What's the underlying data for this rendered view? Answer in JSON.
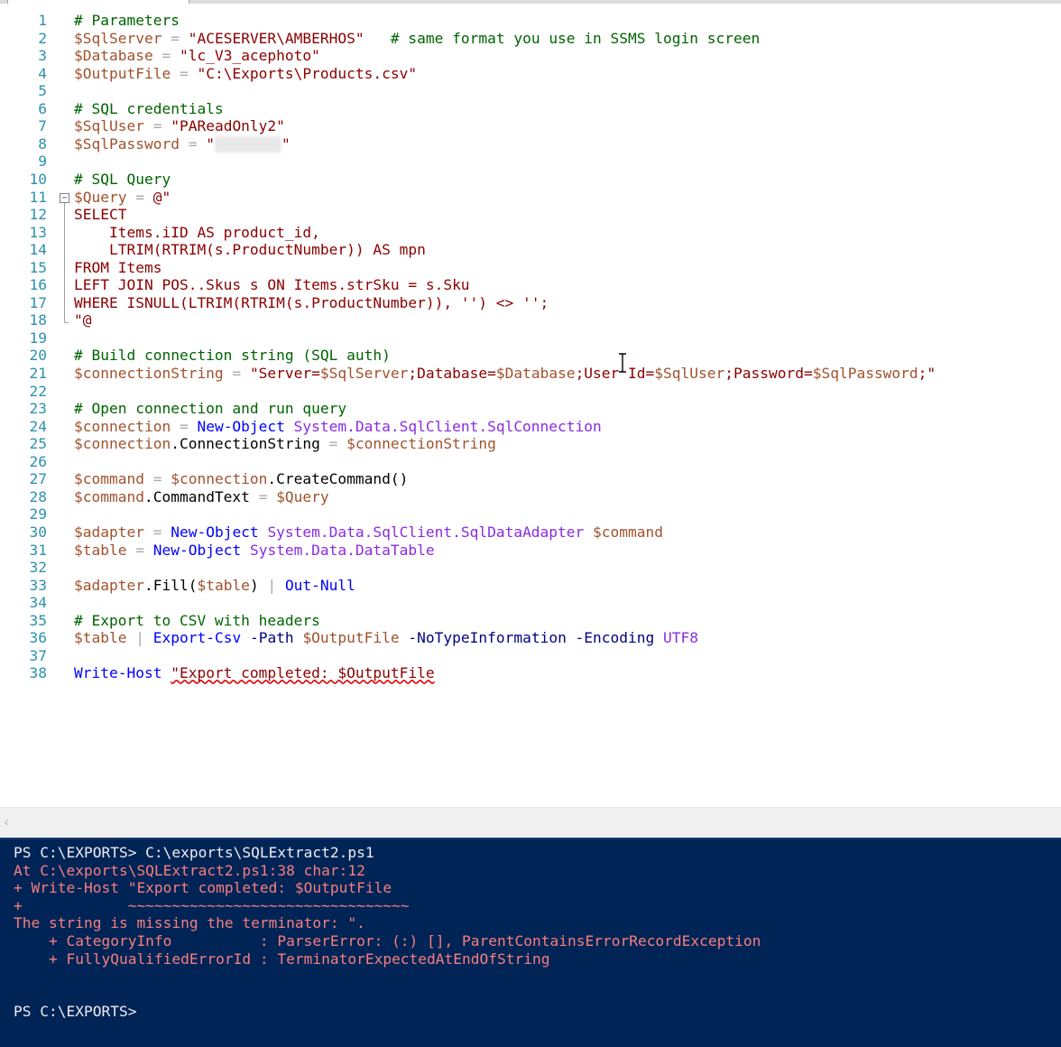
{
  "editor": {
    "lines": [
      {
        "n": "1",
        "tokens": [
          {
            "t": "# Parameters",
            "c": "comment"
          }
        ]
      },
      {
        "n": "2",
        "tokens": [
          {
            "t": "$SqlServer",
            "c": "var"
          },
          {
            "t": " = ",
            "c": "op"
          },
          {
            "t": "\"ACESERVER\\AMBERHOS\"",
            "c": "str"
          },
          {
            "t": "   ",
            "c": "default"
          },
          {
            "t": "# same format you use in SSMS login screen",
            "c": "comment"
          }
        ]
      },
      {
        "n": "3",
        "tokens": [
          {
            "t": "$Database",
            "c": "var"
          },
          {
            "t": " = ",
            "c": "op"
          },
          {
            "t": "\"lc_V3_acephoto\"",
            "c": "str"
          }
        ]
      },
      {
        "n": "4",
        "tokens": [
          {
            "t": "$OutputFile",
            "c": "var"
          },
          {
            "t": " = ",
            "c": "op"
          },
          {
            "t": "\"C:\\Exports\\Products.csv\"",
            "c": "str"
          }
        ]
      },
      {
        "n": "5",
        "tokens": []
      },
      {
        "n": "6",
        "tokens": [
          {
            "t": "# SQL credentials",
            "c": "comment"
          }
        ]
      },
      {
        "n": "7",
        "tokens": [
          {
            "t": "$SqlUser",
            "c": "var"
          },
          {
            "t": " = ",
            "c": "op"
          },
          {
            "t": "\"PAReadOnly2\"",
            "c": "str"
          }
        ]
      },
      {
        "n": "8",
        "tokens": [
          {
            "t": "$SqlPassword",
            "c": "var"
          },
          {
            "t": " = ",
            "c": "op"
          },
          {
            "t": "\"",
            "c": "str"
          },
          {
            "t": "",
            "c": "blur"
          },
          {
            "t": "\"",
            "c": "str"
          }
        ]
      },
      {
        "n": "9",
        "tokens": []
      },
      {
        "n": "10",
        "tokens": [
          {
            "t": "# SQL Query",
            "c": "comment"
          }
        ]
      },
      {
        "n": "11",
        "tokens": [
          {
            "t": "$Query",
            "c": "var"
          },
          {
            "t": " = ",
            "c": "op"
          },
          {
            "t": "@\"",
            "c": "str"
          }
        ]
      },
      {
        "n": "12",
        "tokens": [
          {
            "t": "SELECT",
            "c": "str"
          }
        ]
      },
      {
        "n": "13",
        "tokens": [
          {
            "t": "    Items.iID AS product_id,",
            "c": "str"
          }
        ]
      },
      {
        "n": "14",
        "tokens": [
          {
            "t": "    LTRIM(RTRIM(s.ProductNumber)) AS mpn",
            "c": "str"
          }
        ]
      },
      {
        "n": "15",
        "tokens": [
          {
            "t": "FROM Items",
            "c": "str"
          }
        ]
      },
      {
        "n": "16",
        "tokens": [
          {
            "t": "LEFT JOIN POS..Skus s ON Items.strSku = s.Sku",
            "c": "str"
          }
        ]
      },
      {
        "n": "17",
        "tokens": [
          {
            "t": "WHERE ISNULL(LTRIM(RTRIM(s.ProductNumber)), '') <> '';",
            "c": "str"
          }
        ]
      },
      {
        "n": "18",
        "tokens": [
          {
            "t": "\"@",
            "c": "str"
          }
        ]
      },
      {
        "n": "19",
        "tokens": []
      },
      {
        "n": "20",
        "tokens": [
          {
            "t": "# Build connection string (SQL auth)",
            "c": "comment"
          }
        ]
      },
      {
        "n": "21",
        "tokens": [
          {
            "t": "$connectionString",
            "c": "var"
          },
          {
            "t": " = ",
            "c": "op"
          },
          {
            "t": "\"Server=",
            "c": "str"
          },
          {
            "t": "$SqlServer",
            "c": "var"
          },
          {
            "t": ";Database=",
            "c": "str"
          },
          {
            "t": "$Database",
            "c": "var"
          },
          {
            "t": ";User Id=",
            "c": "str"
          },
          {
            "t": "$SqlUser",
            "c": "var"
          },
          {
            "t": ";Password=",
            "c": "str"
          },
          {
            "t": "$SqlPassword",
            "c": "var"
          },
          {
            "t": ";\"",
            "c": "str"
          }
        ]
      },
      {
        "n": "22",
        "tokens": []
      },
      {
        "n": "23",
        "tokens": [
          {
            "t": "# Open connection and run query",
            "c": "comment"
          }
        ]
      },
      {
        "n": "24",
        "tokens": [
          {
            "t": "$connection",
            "c": "var"
          },
          {
            "t": " = ",
            "c": "op"
          },
          {
            "t": "New-Object",
            "c": "cmd"
          },
          {
            "t": " ",
            "c": "default"
          },
          {
            "t": "System.Data.SqlClient.SqlConnection",
            "c": "type"
          }
        ]
      },
      {
        "n": "25",
        "tokens": [
          {
            "t": "$connection",
            "c": "var"
          },
          {
            "t": ".ConnectionString",
            "c": "default"
          },
          {
            "t": " = ",
            "c": "op"
          },
          {
            "t": "$connectionString",
            "c": "var"
          }
        ]
      },
      {
        "n": "26",
        "tokens": []
      },
      {
        "n": "27",
        "tokens": [
          {
            "t": "$command",
            "c": "var"
          },
          {
            "t": " = ",
            "c": "op"
          },
          {
            "t": "$connection",
            "c": "var"
          },
          {
            "t": ".CreateCommand()",
            "c": "default"
          }
        ]
      },
      {
        "n": "28",
        "tokens": [
          {
            "t": "$command",
            "c": "var"
          },
          {
            "t": ".CommandText",
            "c": "default"
          },
          {
            "t": " = ",
            "c": "op"
          },
          {
            "t": "$Query",
            "c": "var"
          }
        ]
      },
      {
        "n": "29",
        "tokens": []
      },
      {
        "n": "30",
        "tokens": [
          {
            "t": "$adapter",
            "c": "var"
          },
          {
            "t": " = ",
            "c": "op"
          },
          {
            "t": "New-Object",
            "c": "cmd"
          },
          {
            "t": " ",
            "c": "default"
          },
          {
            "t": "System.Data.SqlClient.SqlDataAdapter",
            "c": "type"
          },
          {
            "t": " ",
            "c": "default"
          },
          {
            "t": "$command",
            "c": "var"
          }
        ]
      },
      {
        "n": "31",
        "tokens": [
          {
            "t": "$table",
            "c": "var"
          },
          {
            "t": " = ",
            "c": "op"
          },
          {
            "t": "New-Object",
            "c": "cmd"
          },
          {
            "t": " ",
            "c": "default"
          },
          {
            "t": "System.Data.DataTable",
            "c": "type"
          }
        ]
      },
      {
        "n": "32",
        "tokens": []
      },
      {
        "n": "33",
        "tokens": [
          {
            "t": "$adapter",
            "c": "var"
          },
          {
            "t": ".Fill(",
            "c": "default"
          },
          {
            "t": "$table",
            "c": "var"
          },
          {
            "t": ")",
            "c": "default"
          },
          {
            "t": " | ",
            "c": "op"
          },
          {
            "t": "Out-Null",
            "c": "cmd"
          }
        ]
      },
      {
        "n": "34",
        "tokens": []
      },
      {
        "n": "35",
        "tokens": [
          {
            "t": "# Export to CSV with headers",
            "c": "comment"
          }
        ]
      },
      {
        "n": "36",
        "tokens": [
          {
            "t": "$table",
            "c": "var"
          },
          {
            "t": " | ",
            "c": "op"
          },
          {
            "t": "Export-Csv",
            "c": "cmd"
          },
          {
            "t": " -Path ",
            "c": "param"
          },
          {
            "t": "$OutputFile",
            "c": "var"
          },
          {
            "t": " -NoTypeInformation -Encoding ",
            "c": "param"
          },
          {
            "t": "UTF8",
            "c": "type"
          }
        ]
      },
      {
        "n": "37",
        "tokens": []
      },
      {
        "n": "38",
        "tokens": [
          {
            "t": "Write-Host",
            "c": "cmd"
          },
          {
            "t": " ",
            "c": "default"
          },
          {
            "t": "\"Export completed: $OutputFile",
            "c": "squiggle"
          }
        ]
      }
    ]
  },
  "console": {
    "lines": [
      {
        "t": "PS C:\\EXPORTS> C:\\exports\\SQLExtract2.ps1",
        "c": "white"
      },
      {
        "t": "At C:\\exports\\SQLExtract2.ps1:38 char:12",
        "c": "err"
      },
      {
        "t": "+ Write-Host \"Export completed: $OutputFile",
        "c": "err"
      },
      {
        "t": "+            ~~~~~~~~~~~~~~~~~~~~~~~~~~~~~~~~",
        "c": "err"
      },
      {
        "t": "The string is missing the terminator: \".",
        "c": "err"
      },
      {
        "t": "    + CategoryInfo          : ParserError: (:) [], ParentContainsErrorRecordException",
        "c": "err"
      },
      {
        "t": "    + FullyQualifiedErrorId : TerminatorExpectedAtEndOfString",
        "c": "err"
      },
      {
        "t": "",
        "c": "white"
      },
      {
        "t": "",
        "c": "white"
      },
      {
        "t": "PS C:\\EXPORTS>",
        "c": "white"
      }
    ]
  },
  "icons": {
    "fold": "collapse-region-icon",
    "cursor": "text-cursor-icon",
    "scroll_left": "scroll-left-arrow-icon"
  },
  "colors": {
    "console_bg": "#012456",
    "error_text": "#f57f7f",
    "comment": "#006400",
    "string": "#8b0000"
  }
}
